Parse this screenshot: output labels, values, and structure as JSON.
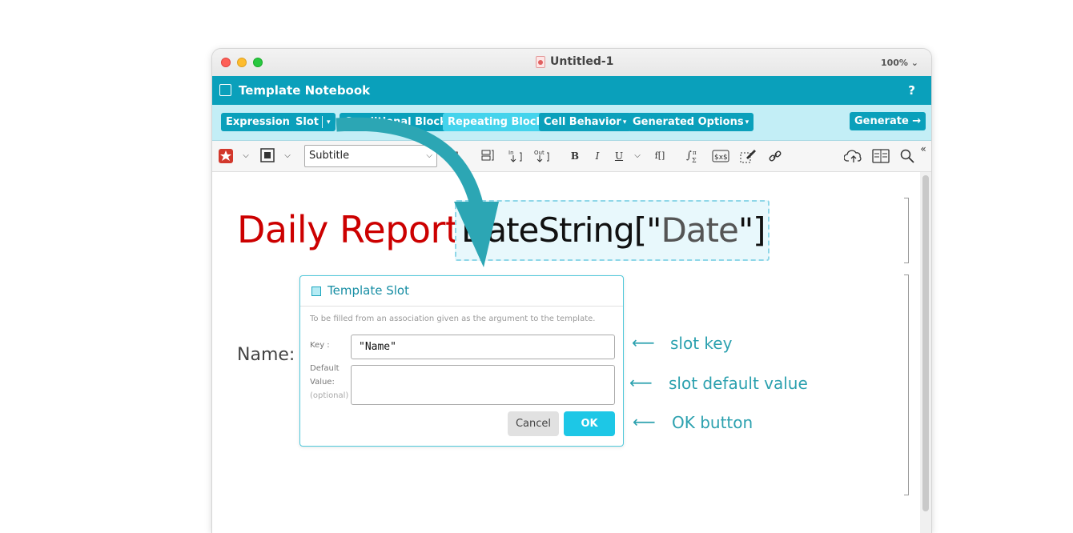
{
  "window": {
    "title": "Untitled-1",
    "zoom": "100%"
  },
  "header": {
    "title": "Template Notebook",
    "help": "?"
  },
  "buttonbar": {
    "expression": "Expression",
    "slot": "Slot",
    "conditional": "Conditional Block",
    "repeating": "Repeating Block",
    "cell_behavior": "Cell Behavior",
    "generated_options": "Generated Options",
    "generate": "Generate →"
  },
  "toolbar": {
    "style": "Subtitle"
  },
  "notebook": {
    "report_title": "Daily Report:",
    "slot_expr_head": "DateString[\"",
    "slot_expr_str": "Date",
    "slot_expr_tail": "\"]",
    "name_label": "Name:"
  },
  "dialog": {
    "title": "Template Slot",
    "description": "To be filled from an association given as the argument to the template.",
    "key_label": "Key :",
    "key_value": "\"Name\"",
    "default_label_1": "Default",
    "default_label_2": "Value:",
    "default_optional": "(optional)",
    "cancel": "Cancel",
    "ok": "OK"
  },
  "callouts": {
    "slot_key": "slot key",
    "slot_default": "slot default value",
    "ok_button": "OK button"
  },
  "colors": {
    "accent": "#0aa0bb",
    "accent_light": "#44d3ec",
    "title_red": "#cc0000",
    "callout": "#2ca1af"
  }
}
